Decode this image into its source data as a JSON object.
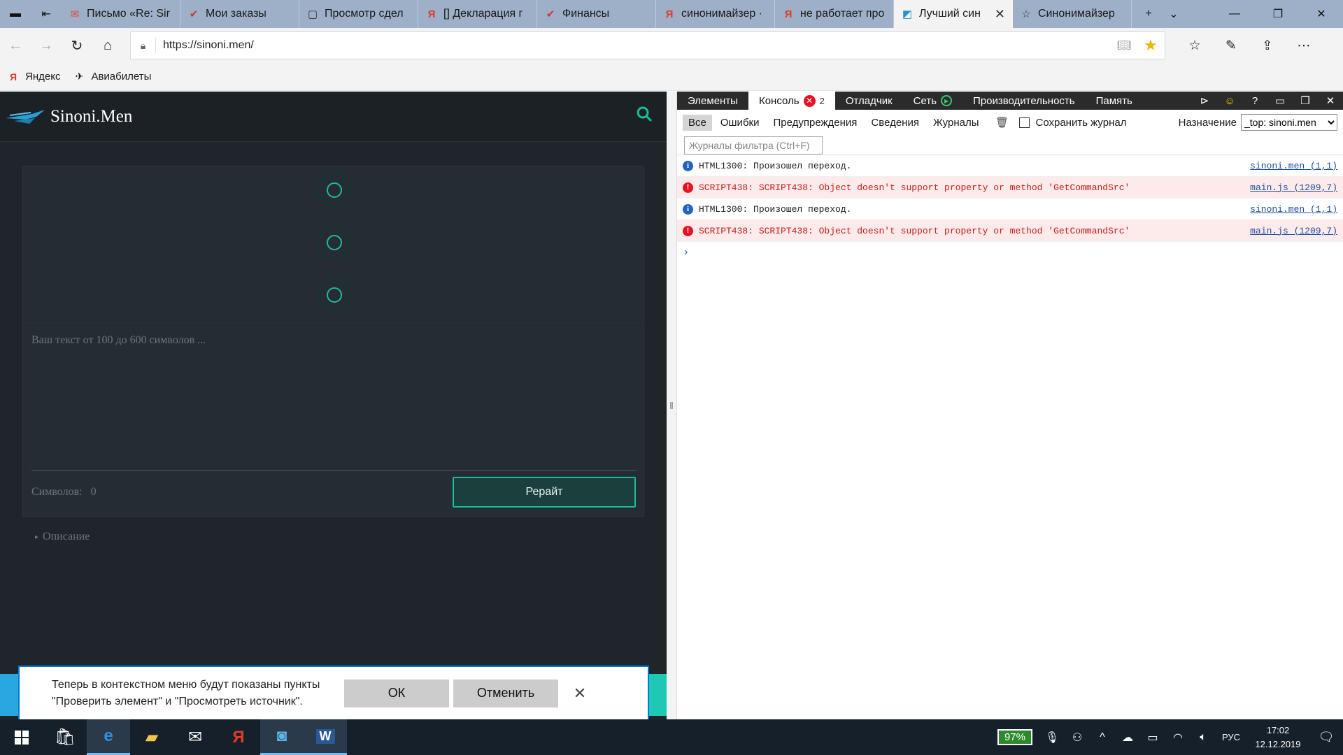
{
  "browser": {
    "tabs": [
      {
        "title": "Письмо «Re: Sir",
        "favicon": "mail-icon",
        "color": "#e34a2a"
      },
      {
        "title": "Мои заказы",
        "favicon": "checkmark-icon",
        "color": "#d0342c"
      },
      {
        "title": "Просмотр сдел",
        "favicon": "page-icon",
        "color": "#333333"
      },
      {
        "title": "[] Декларация г",
        "favicon": "yandex-icon",
        "color": "#e03a2a"
      },
      {
        "title": "Финансы",
        "favicon": "checkmark-icon",
        "color": "#d0342c"
      },
      {
        "title": "синонимайзер ·",
        "favicon": "yandex-icon",
        "color": "#e03a2a"
      },
      {
        "title": "не работает про",
        "favicon": "yandex-icon",
        "color": "#e03a2a"
      },
      {
        "title": "Лучший син",
        "favicon": "site-icon",
        "color": "#2a8fd0",
        "active": true
      },
      {
        "title": "Синонимайзер",
        "favicon": "star-icon",
        "color": "#333333"
      }
    ],
    "url": "https://sinoni.men/",
    "favorites": [
      {
        "label": "Яндекс",
        "icon": "yandex-icon"
      },
      {
        "label": "Авиабилеты",
        "icon": "plane-icon"
      }
    ]
  },
  "site": {
    "logo_text": "Sinoni.Men",
    "textarea_placeholder": "Ваш текст от 100 до 600 символов ...",
    "counter_label": "Символов:",
    "counter_value": "0",
    "rewrite_label": "Рерайт",
    "description_label": "Описание"
  },
  "notification": {
    "message": "Теперь в контекстном меню будут показаны пункты \"Проверить элемент\" и \"Просмотреть источник\".",
    "ok_label": "ОК",
    "cancel_label": "Отменить"
  },
  "devtools": {
    "tabs": {
      "elements": "Элементы",
      "console": "Консоль",
      "console_errors": "2",
      "debugger": "Отладчик",
      "network": "Сеть",
      "performance": "Производительность",
      "memory": "Память"
    },
    "filters": {
      "all": "Все",
      "errors": "Ошибки",
      "warnings": "Предупреждения",
      "info": "Сведения",
      "logs": "Журналы",
      "preserve_log": "Сохранить журнал",
      "target_label": "Назначение",
      "target_value": "_top: sinoni.men",
      "filter_placeholder": "Журналы фильтра (Ctrl+F)"
    },
    "console_rows": [
      {
        "type": "info",
        "text": "HTML1300: Произошел переход.",
        "source": "sinoni.men (1,1)"
      },
      {
        "type": "err",
        "text": "SCRIPT438: SCRIPT438: Object doesn't support property or method 'GetCommandSrc'",
        "source": "main.js (1209,7)"
      },
      {
        "type": "info",
        "text": "HTML1300: Произошел переход.",
        "source": "sinoni.men (1,1)"
      },
      {
        "type": "err",
        "text": "SCRIPT438: SCRIPT438: Object doesn't support property or method 'GetCommandSrc'",
        "source": "main.js (1209,7)"
      }
    ]
  },
  "taskbar": {
    "battery": "97%",
    "language": "РУС",
    "time": "17:02",
    "date": "12.12.2019"
  },
  "colors": {
    "accent": "#1abc9c",
    "site_bg": "#20252b",
    "error_bg": "#fdeaea",
    "error_text": "#c41e1e"
  }
}
